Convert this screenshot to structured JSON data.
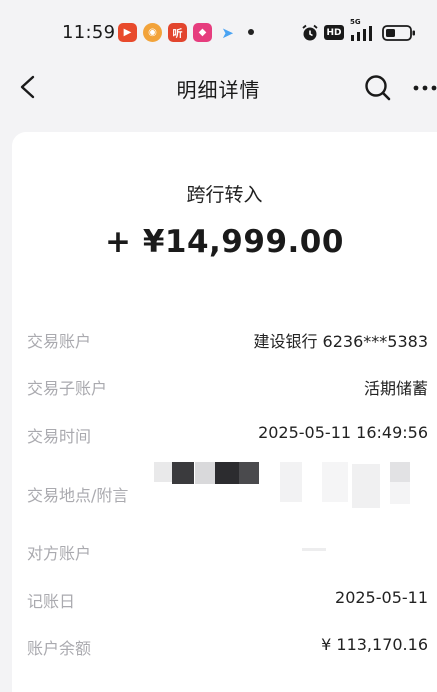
{
  "status_bar": {
    "time": "11:59",
    "app_icons": [
      {
        "name": "video-app-icon",
        "glyph": "▶",
        "color": "#e84a2c"
      },
      {
        "name": "weibo-icon",
        "glyph": "◉",
        "color": "#f2a33a"
      },
      {
        "name": "listen-app-icon",
        "glyph": "听",
        "color": "#e2452e"
      },
      {
        "name": "shopping-app-icon",
        "glyph": "◆",
        "color": "#e63d7e"
      },
      {
        "name": "play-store-icon",
        "glyph": "➤",
        "color": "#4aa3f2"
      }
    ],
    "indicators": [
      "alarm-icon",
      "hd-icon",
      "5g-signal-icon",
      "battery-icon"
    ],
    "hd_text": "HD",
    "network_text": "5G"
  },
  "header": {
    "title": "明细详情",
    "icons": [
      "back-arrow-icon",
      "search-icon",
      "more-icon"
    ]
  },
  "transaction": {
    "type_label": "跨行转入",
    "amount": "+ ¥14,999.00",
    "rows": [
      {
        "label": "交易账户",
        "value": "建设银行 6236***5383"
      },
      {
        "label": "交易子账户",
        "value": "活期储蓄"
      },
      {
        "label": "交易时间",
        "value": "2025-05-11 16:49:56"
      },
      {
        "label": "交易地点/附言",
        "value": ""
      },
      {
        "label": "对方账户",
        "value": ""
      },
      {
        "label": "记账日",
        "value": "2025-05-11"
      },
      {
        "label": "账户余额",
        "value": "¥ 113,170.16"
      }
    ]
  }
}
